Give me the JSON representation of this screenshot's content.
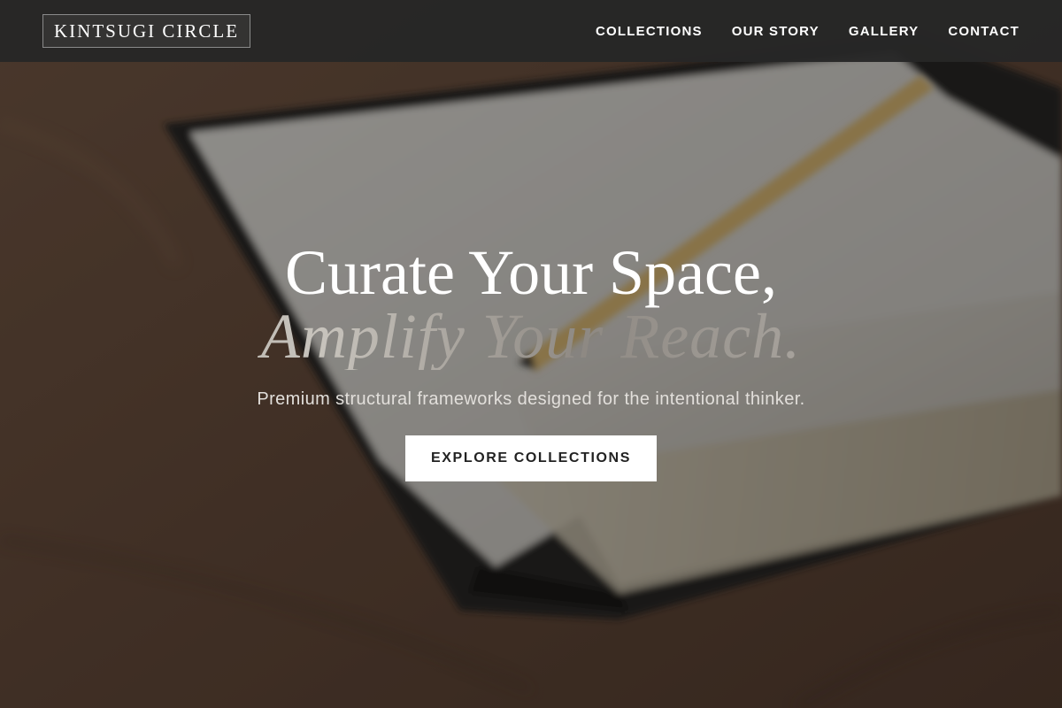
{
  "header": {
    "logo": "KINTSUGI CIRCLE",
    "nav": [
      {
        "label": "COLLECTIONS"
      },
      {
        "label": "OUR STORY"
      },
      {
        "label": "GALLERY"
      },
      {
        "label": "CONTACT"
      }
    ]
  },
  "hero": {
    "headline_line1": "Curate Your Space,",
    "headline_line2": "Amplify Your Reach.",
    "subtitle": "Premium structural frameworks designed for the intentional thinker.",
    "cta_label": "EXPLORE COLLECTIONS",
    "background_image": "open-notebook-with-pencil-on-wooden-desk"
  },
  "colors": {
    "header_bg": "#262626",
    "cta_bg": "#ffffff",
    "cta_text": "#222222",
    "headline": "#ffffff",
    "headline_accent": "#b9b4ad"
  }
}
